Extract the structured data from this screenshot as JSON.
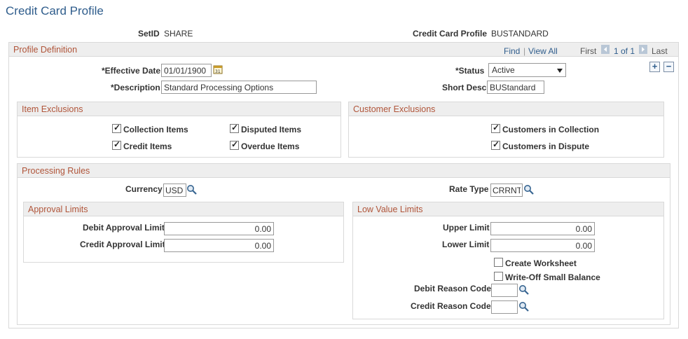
{
  "page": {
    "title": "Credit Card Profile"
  },
  "header": {
    "setid_label": "SetID",
    "setid_value": "SHARE",
    "profile_label": "Credit Card Profile",
    "profile_value": "BUSTANDARD"
  },
  "profile_definition": {
    "title": "Profile Definition",
    "find": "Find",
    "separator": "|",
    "view_all": "View All",
    "first": "First",
    "count": "1 of 1",
    "last": "Last",
    "effective_date_label": "*Effective Date",
    "effective_date_value": "01/01/1900",
    "status_label": "*Status",
    "status_value": "Active",
    "description_label": "*Description",
    "description_value": "Standard Processing Options",
    "short_desc_label": "Short Desc",
    "short_desc_value": "BUStandard",
    "add_row": "+",
    "delete_row": "−"
  },
  "item_exclusions": {
    "title": "Item Exclusions",
    "collection_items": "Collection Items",
    "disputed_items": "Disputed Items",
    "credit_items": "Credit Items",
    "overdue_items": "Overdue Items"
  },
  "customer_exclusions": {
    "title": "Customer Exclusions",
    "in_collection": "Customers in Collection",
    "in_dispute": "Customers in Dispute"
  },
  "processing_rules": {
    "title": "Processing Rules",
    "currency_label": "Currency",
    "currency_value": "USD",
    "rate_type_label": "Rate Type",
    "rate_type_value": "CRRNT"
  },
  "approval_limits": {
    "title": "Approval Limits",
    "debit_label": "Debit Approval Limit",
    "debit_value": "0.00",
    "credit_label": "Credit Approval Limit",
    "credit_value": "0.00"
  },
  "low_value_limits": {
    "title": "Low Value Limits",
    "upper_label": "Upper Limit",
    "upper_value": "0.00",
    "lower_label": "Lower Limit",
    "lower_value": "0.00",
    "create_worksheet": "Create Worksheet",
    "write_off": "Write-Off Small Balance",
    "debit_reason_label": "Debit Reason Code",
    "credit_reason_label": "Credit Reason Code"
  }
}
